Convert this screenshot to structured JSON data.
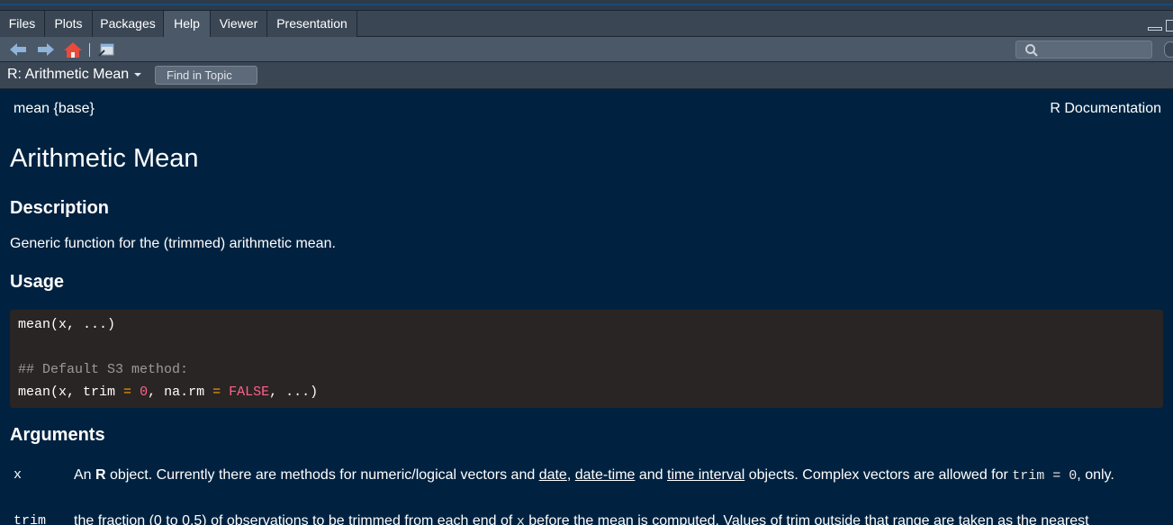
{
  "tabs": [
    "Files",
    "Plots",
    "Packages",
    "Help",
    "Viewer",
    "Presentation"
  ],
  "active_tab": "Help",
  "toolbar": {
    "back_icon": "back-arrow-icon",
    "forward_icon": "forward-arrow-icon",
    "home_icon": "home-icon",
    "popout_icon": "show-in-new-window-icon",
    "search_placeholder": "",
    "search_icon": "search-icon"
  },
  "topic": {
    "title": "R: Arithmetic Mean",
    "find_placeholder": "Find in Topic"
  },
  "doc": {
    "header_left": "mean {base}",
    "header_right": "R Documentation",
    "title": "Arithmetic Mean",
    "description_heading": "Description",
    "description": "Generic function for the (trimmed) arithmetic mean.",
    "usage_heading": "Usage",
    "usage": {
      "line1": "mean(x, ...)",
      "comment": "## Default S3 method:",
      "line3_a": "mean(x, trim ",
      "eq1": "=",
      "sp1": " ",
      "zero": "0",
      "line3_b": ", na.rm ",
      "eq2": "=",
      "sp2": " ",
      "false_kw": "FALSE",
      "line3_c": ", ...)"
    },
    "arguments_heading": "Arguments",
    "args": [
      {
        "name": "x",
        "t1": "An ",
        "bold": "R",
        "t2": " object. Currently there are methods for numeric/logical vectors and ",
        "link1": "date",
        "t3": ", ",
        "link2": "date-time",
        "t4": " and ",
        "link3": "time interval",
        "t5": " objects. Complex vectors are allowed for ",
        "code": "trim = 0",
        "t6": ", only."
      },
      {
        "name": "trim",
        "t1": "the fraction (0 to 0.5) of observations to be trimmed from each end of ",
        "code": "x",
        "t2": " before the mean is computed. Values of trim outside that range are taken as the nearest"
      }
    ]
  },
  "colors": {
    "background": "#002240",
    "code_background": "#292524",
    "operator": "#ff9d00",
    "constant": "#ff628c",
    "comment": "#9a9a9a"
  }
}
